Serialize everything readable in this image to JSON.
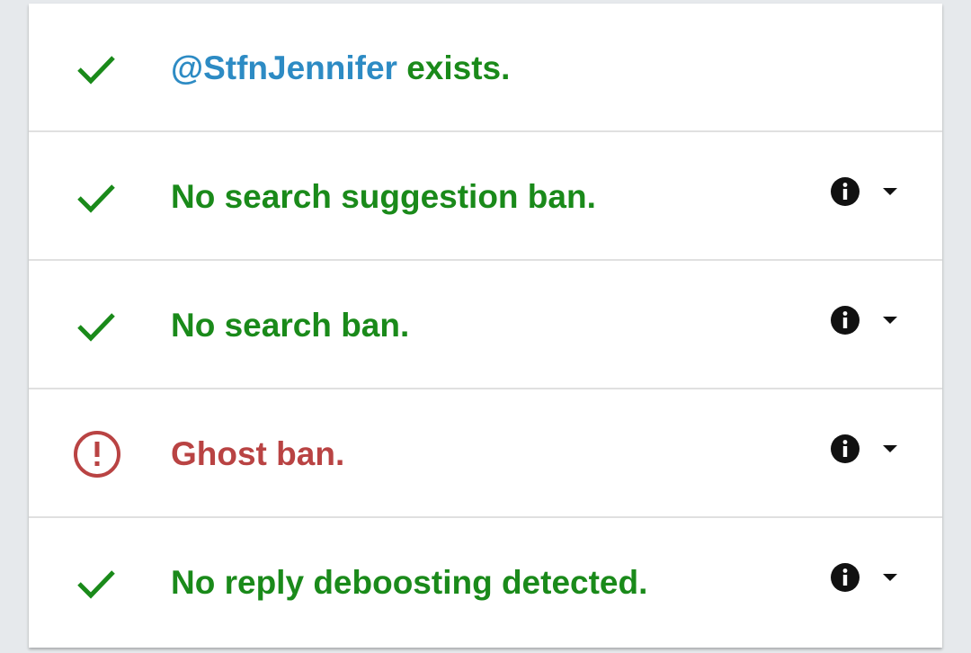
{
  "colors": {
    "ok": "#1a8a1a",
    "warn": "#b94343",
    "handle": "#2d8bc4",
    "icon": "#111111"
  },
  "rows": [
    {
      "status": "ok",
      "status_icon": "check-icon",
      "handle": "@StfnJennifer",
      "text": " exists.",
      "has_details": false
    },
    {
      "status": "ok",
      "status_icon": "check-icon",
      "text": "No search suggestion ban.",
      "has_details": true,
      "info_icon": "info-icon",
      "toggle_icon": "caret-down-icon"
    },
    {
      "status": "ok",
      "status_icon": "check-icon",
      "text": "No search ban.",
      "has_details": true,
      "info_icon": "info-icon",
      "toggle_icon": "caret-down-icon"
    },
    {
      "status": "warn",
      "status_icon": "alert-circle-icon",
      "text": "Ghost ban.",
      "has_details": true,
      "info_icon": "info-icon",
      "toggle_icon": "caret-down-icon"
    },
    {
      "status": "ok",
      "status_icon": "check-icon",
      "text": "No reply deboosting detected.",
      "has_details": true,
      "info_icon": "info-icon",
      "toggle_icon": "caret-down-icon"
    }
  ]
}
